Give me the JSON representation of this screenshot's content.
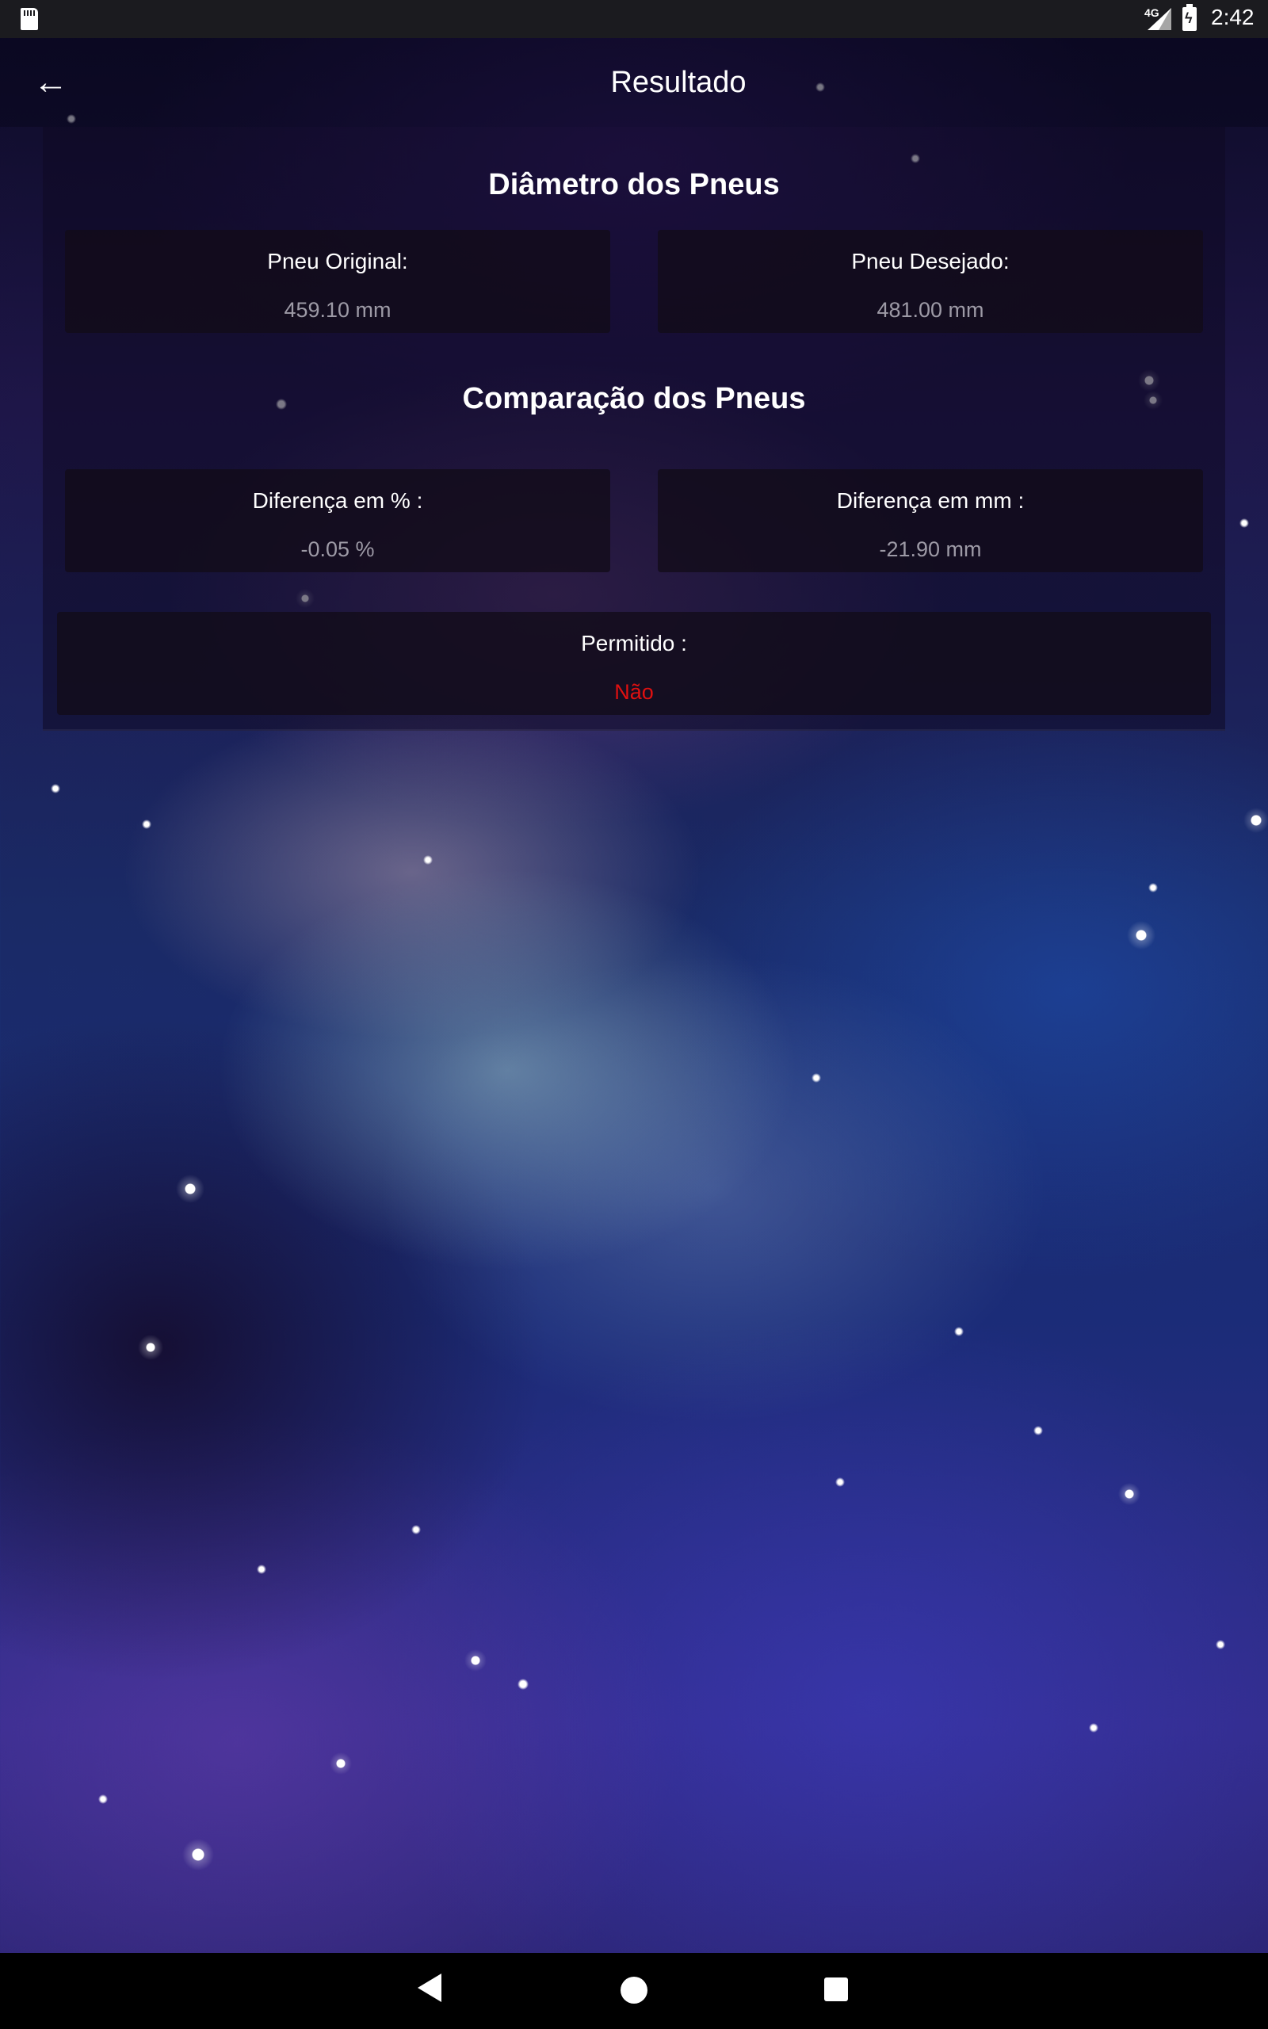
{
  "status_bar": {
    "network": "4G",
    "time": "2:42",
    "icons": [
      "sd-card-icon",
      "signal-icon",
      "battery-charging-icon"
    ]
  },
  "app_bar": {
    "title": "Resultado",
    "back_icon": "arrow-left-icon"
  },
  "diameter_section": {
    "title": "Diâmetro dos Pneus",
    "original": {
      "label": "Pneu Original:",
      "value": "459.10 mm"
    },
    "desired": {
      "label": "Pneu Desejado:",
      "value": "481.00 mm"
    }
  },
  "comparison_section": {
    "title": "Comparação dos Pneus",
    "diff_percent": {
      "label": "Diferença em % :",
      "value": "-0.05 %"
    },
    "diff_mm": {
      "label": "Diferença em mm :",
      "value": "-21.90 mm"
    },
    "allowed": {
      "label": "Permitido :",
      "value": "Não"
    }
  },
  "colors": {
    "not_allowed": "#e01010",
    "value_text": "#9d9aa6"
  },
  "nav_bar": {
    "icons": [
      "back-triangle-icon",
      "home-circle-icon",
      "recents-square-icon"
    ]
  }
}
